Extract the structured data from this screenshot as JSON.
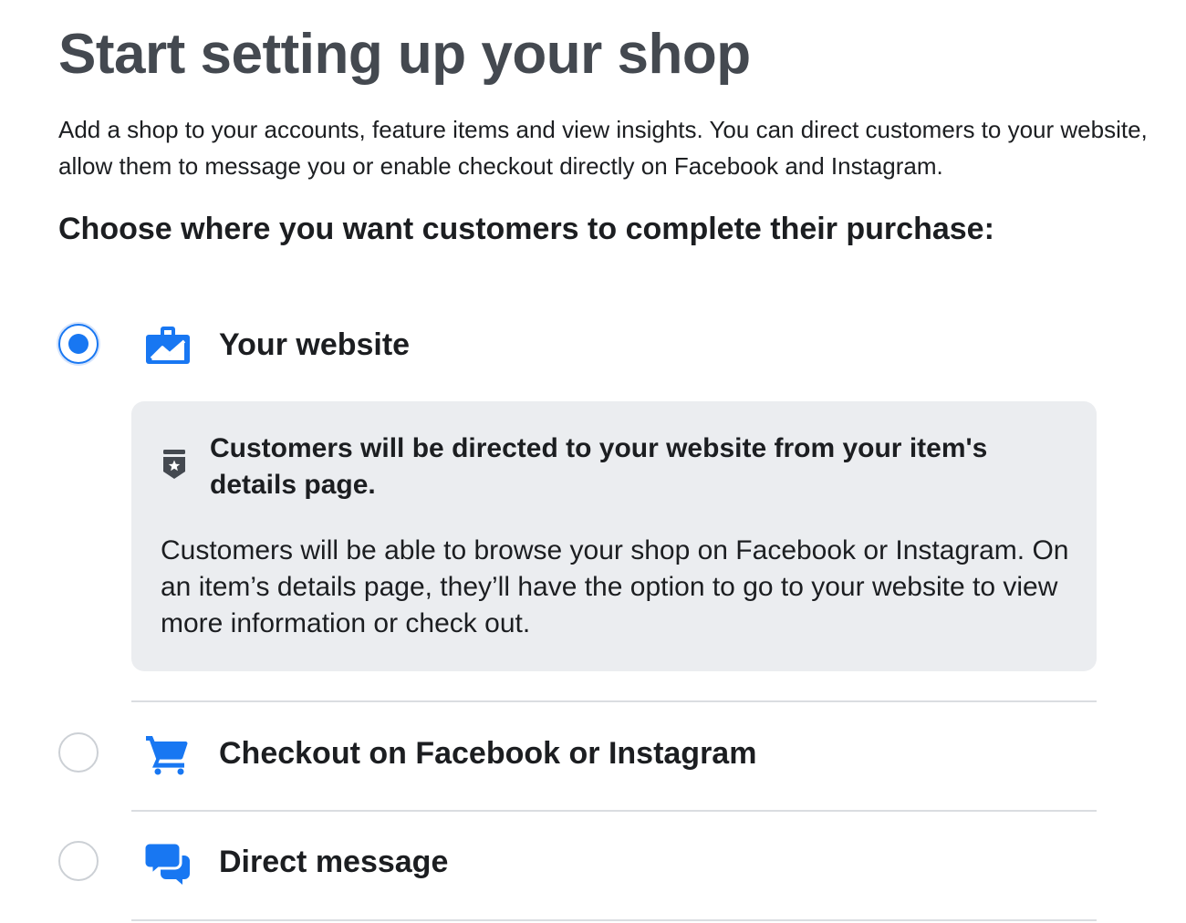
{
  "header": {
    "title": "Start setting up your shop",
    "description": "Add a shop to your accounts, feature items and view insights. You can direct customers to your website, allow them to message you or enable checkout directly on Facebook and Instagram.",
    "question": "Choose where you want customers to complete their purchase:"
  },
  "options": [
    {
      "label": "Your website",
      "icon": "website-briefcase-icon",
      "selected": true
    },
    {
      "label": "Checkout on Facebook or Instagram",
      "icon": "shopping-cart-icon",
      "selected": false
    },
    {
      "label": "Direct message",
      "icon": "chat-bubbles-icon",
      "selected": false
    }
  ],
  "info_box": {
    "icon": "badge-star-icon",
    "heading": "Customers will be directed to your website from your item's details page.",
    "body": "Customers will be able to browse your shop on Facebook or Instagram. On an item’s details page, they’ll have the option to go to your website to view more information or check out."
  },
  "colors": {
    "accent": "#1877f2",
    "title_text": "#444950",
    "body_text": "#1c1e21",
    "info_box_bg": "#ebedf0",
    "divider": "#dadde1",
    "radio_border": "#ccd0d5"
  }
}
